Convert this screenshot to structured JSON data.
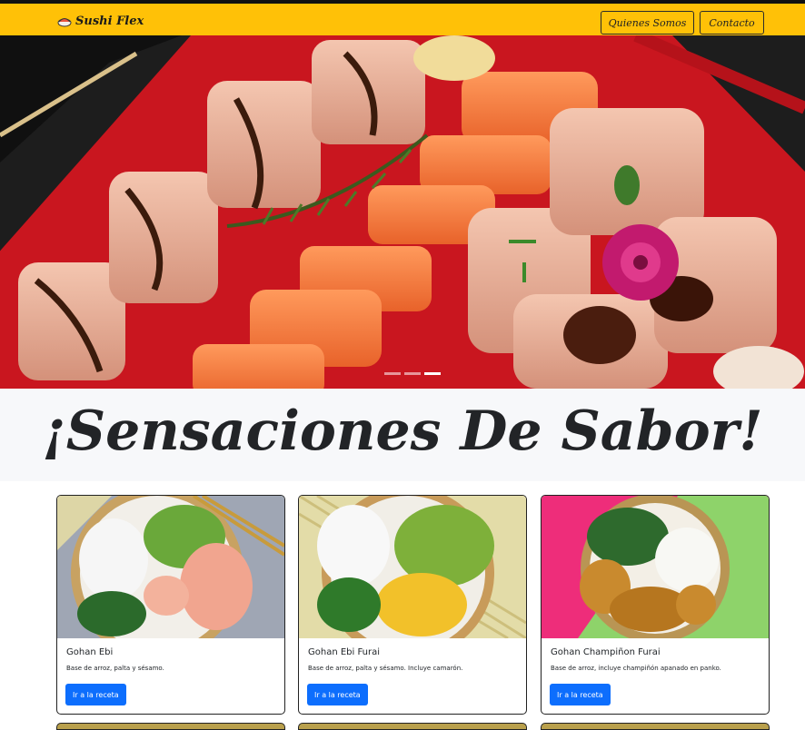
{
  "navbar": {
    "brand": "Sushi Flex",
    "brand_icon": "sushi-icon",
    "links": [
      "Quienes Somos",
      "Contacto"
    ],
    "bg_color": "#ffc107"
  },
  "hero": {
    "image": "sushi-platter-photo",
    "slides": 3,
    "active_slide": 2
  },
  "page_title": "¡Sensaciones De Sabor!",
  "cards": [
    {
      "title": "Gohan Ebi",
      "text": "Base de arroz, palta y sésamo.",
      "button": "Ir a la receta"
    },
    {
      "title": "Gohan Ebi Furai",
      "text": "Base de arroz, palta y sésamo. Incluye camarón.",
      "button": "Ir a la receta"
    },
    {
      "title": "Gohan Champiñon Furai",
      "text": "Base de arroz, incluye champiñón apanado en panko.",
      "button": "Ir a la receta"
    }
  ],
  "colors": {
    "accent": "#ffc107",
    "button": "#0d6efd",
    "title": "#222427"
  }
}
